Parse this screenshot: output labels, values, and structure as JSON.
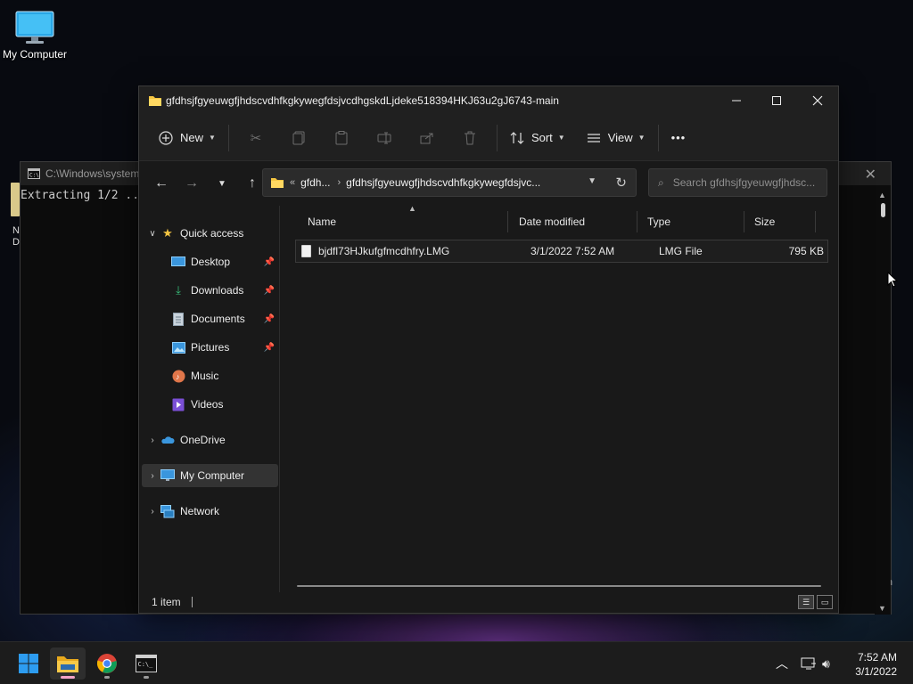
{
  "desktop": {
    "icons": [
      {
        "label": "My Computer"
      }
    ],
    "partial_doc_label": "N\nDoc"
  },
  "console": {
    "title": "C:\\Windows\\system",
    "output": "Extracting 1/2 ..",
    "tail_text": "n"
  },
  "explorer": {
    "title": "gfdhsjfgyeuwgfjhdscvdhfkgkywegfdsjvcdhgskdLjdeke518394HKJ63u2gJ6743-main",
    "toolbar": {
      "new_label": "New",
      "sort_label": "Sort",
      "view_label": "View",
      "more_label": "•••"
    },
    "address": {
      "overflow": "«",
      "segments": [
        "gfdh...",
        "gfdhsjfgyeuwgfjhdscvdhfkgkywegfdsjvc..."
      ]
    },
    "search": {
      "placeholder": "Search gfdhsjfgyeuwgfjhdsc..."
    },
    "nav": {
      "quick_access": "Quick access",
      "pinned": [
        {
          "label": "Desktop",
          "icon": "desktop-icon"
        },
        {
          "label": "Downloads",
          "icon": "download-icon"
        },
        {
          "label": "Documents",
          "icon": "documents-icon"
        },
        {
          "label": "Pictures",
          "icon": "pictures-icon"
        }
      ],
      "others": [
        {
          "label": "Music",
          "icon": "music-icon"
        },
        {
          "label": "Videos",
          "icon": "videos-icon"
        }
      ],
      "onedrive": "OneDrive",
      "my_computer": "My Computer",
      "network": "Network"
    },
    "columns": [
      "Name",
      "Date modified",
      "Type",
      "Size"
    ],
    "files": [
      {
        "name": "bjdfl73HJkufgfmcdhfry.LMG",
        "date": "3/1/2022 7:52 AM",
        "type": "LMG File",
        "size": "795 KB"
      }
    ],
    "status": "1 item"
  },
  "taskbar": {
    "apps": [
      "start-icon",
      "file-explorer-icon",
      "chrome-icon",
      "terminal-icon"
    ],
    "clock": {
      "time": "7:52 AM",
      "date": "3/1/2022"
    }
  },
  "colors": {
    "accent": "#3a96dd",
    "folder": "#f4c542",
    "explorer_bg": "#191919",
    "console_bg": "#0c0c0c"
  }
}
